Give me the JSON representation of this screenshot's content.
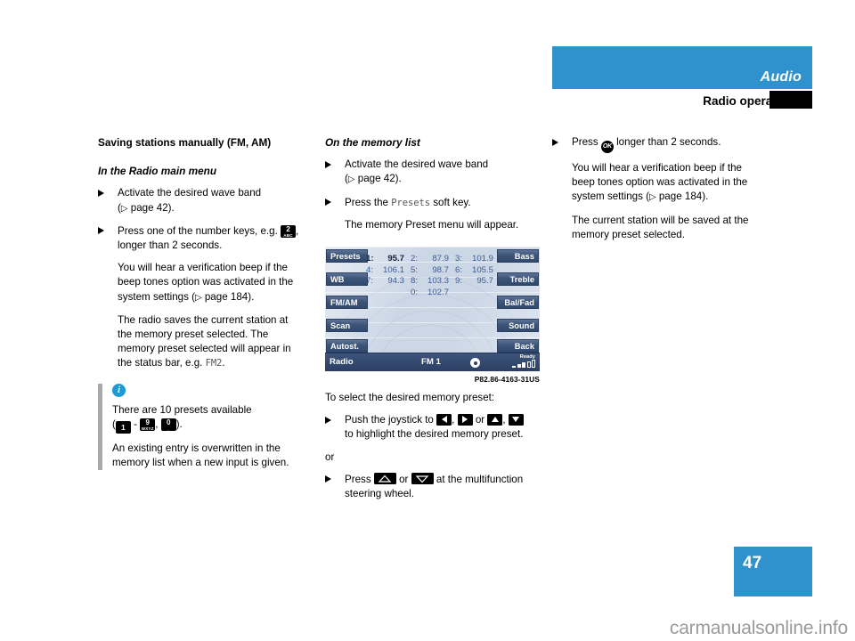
{
  "header": {
    "title": "Audio",
    "section": "Radio operation",
    "accent_color": "#2f92cd"
  },
  "page_number": "47",
  "watermark": "carmanualsonline.info",
  "left_column": {
    "heading": "Saving stations manually (FM, AM)",
    "subheading": "In the Radio main menu",
    "bullet1_line1": "Activate the desired wave band",
    "bullet1_line2_prefix": "(",
    "bullet1_line2_ref": "page 42",
    "bullet1_line2_suffix": ").",
    "bullet2_prefix": "Press one of the number keys, e.g.",
    "bullet2_key_number": "2",
    "bullet2_key_letters": "ABC",
    "bullet2_suffix": ", longer than 2 seconds.",
    "para1": "You will hear a verification beep if the beep tones option was activated in the system settings (",
    "para1_ref": "page 184",
    "para1_end": ").",
    "para2_prefix": "The radio saves the current station at the memory preset selected. The memory preset selected will appear in the status bar, e.g.",
    "para2_mono": "FM2",
    "para2_suffix": ".",
    "note": {
      "icon": "info-icon",
      "line1_prefix": "There are 10 presets available",
      "line2_open": "(",
      "key_first_number": "1",
      "key_first_letters": "",
      "dash": "-",
      "key_second_number": "9",
      "key_second_letters": "WXYZ",
      "comma": ",",
      "key_third_number": "0",
      "key_third_letters": "_",
      "line2_close": ").",
      "line3": "An existing entry is overwritten in the memory list when a new input is given."
    }
  },
  "middle_column": {
    "subheading": "On the memory list",
    "bullet1_line1": "Activate the desired wave band",
    "bullet1_line2_prefix": "(",
    "bullet1_line2_ref": "page 42",
    "bullet1_line2_suffix": ").",
    "bullet2_prefix": "Press the",
    "bullet2_mono": "Presets",
    "bullet2_suffix": "soft key.",
    "para1": "The memory Preset menu will appear.",
    "figure_caption": "P82.86-4163-31US",
    "lead_in": "To select the desired memory preset:",
    "bullet3_prefix": "Push the joystick to",
    "bullet3_mid1": ",",
    "bullet3_or": "or",
    "bullet3_mid2": ",",
    "bullet3_suffix": "to highlight the desired memory preset.",
    "or_word": "or",
    "bullet4_prefix": "Press",
    "bullet4_or": "or",
    "bullet4_suffix": "at the multifunction steering wheel."
  },
  "right_column": {
    "bullet1_prefix": "Press",
    "bullet1_key": "OK",
    "bullet1_suffix": "longer than 2 seconds.",
    "para1": "You will hear a verification beep if the beep tones option was activated in the system settings (",
    "para1_ref": "page 184",
    "para1_end": ").",
    "para2": "The current station will be saved at the memory preset selected."
  },
  "radio_display": {
    "left_softkeys": [
      "Presets",
      "WB",
      "FM/AM",
      "Scan",
      "Autost."
    ],
    "right_softkeys": [
      "Bass",
      "Treble",
      "Bal/Fad",
      "Sound",
      "Back"
    ],
    "presets": [
      [
        {
          "index": "1:",
          "freq": "95.7",
          "selected": true
        },
        {
          "index": "2:",
          "freq": "87.9",
          "selected": false
        },
        {
          "index": "3:",
          "freq": "101.9",
          "selected": false
        }
      ],
      [
        {
          "index": "4:",
          "freq": "106.1",
          "selected": false
        },
        {
          "index": "5:",
          "freq": "98.7",
          "selected": false
        },
        {
          "index": "6:",
          "freq": "105.5",
          "selected": false
        }
      ],
      [
        {
          "index": "7:",
          "freq": "94.3",
          "selected": false
        },
        {
          "index": "8:",
          "freq": "103.3",
          "selected": false
        },
        {
          "index": "9:",
          "freq": "95.7",
          "selected": false
        }
      ],
      [
        {
          "index": "",
          "freq": "",
          "selected": false
        },
        {
          "index": "0:",
          "freq": "102.7",
          "selected": false
        },
        {
          "index": "",
          "freq": "",
          "selected": false
        }
      ]
    ],
    "status_source": "Radio",
    "status_band": "FM 1",
    "status_ready": "Ready",
    "screen_bg_color": "#ccd7e6",
    "softkey_color": "#3d5479",
    "text_color": "#3c5c96"
  }
}
